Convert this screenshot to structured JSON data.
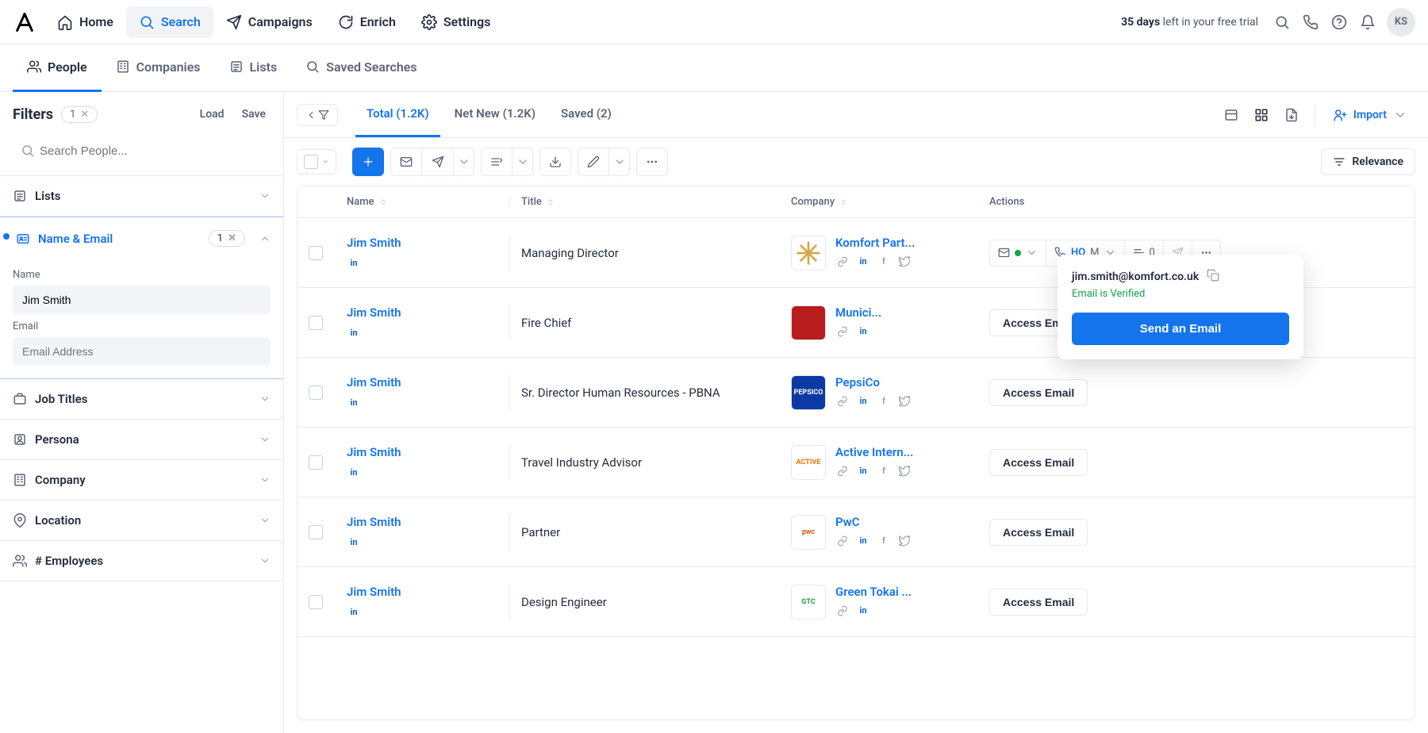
{
  "topnav": {
    "items": [
      {
        "id": "home",
        "label": "Home"
      },
      {
        "id": "search",
        "label": "Search"
      },
      {
        "id": "campaigns",
        "label": "Campaigns"
      },
      {
        "id": "enrich",
        "label": "Enrich"
      },
      {
        "id": "settings",
        "label": "Settings"
      }
    ],
    "trial_bold": "35 days",
    "trial_rest": " left in your free trial",
    "avatar_initials": "KS"
  },
  "subnav": {
    "items": [
      {
        "id": "people",
        "label": "People"
      },
      {
        "id": "companies",
        "label": "Companies"
      },
      {
        "id": "lists",
        "label": "Lists"
      },
      {
        "id": "saved",
        "label": "Saved Searches"
      }
    ]
  },
  "filters": {
    "title": "Filters",
    "count": "1",
    "load": "Load",
    "save": "Save",
    "search_placeholder": "Search People...",
    "name_email": {
      "title": "Name & Email",
      "count": "1",
      "name_label": "Name",
      "name_value": "Jim Smith",
      "email_label": "Email",
      "email_placeholder": "Email Address"
    },
    "sections": [
      {
        "id": "lists",
        "label": "Lists"
      },
      {
        "id": "job_titles",
        "label": "Job Titles"
      },
      {
        "id": "persona",
        "label": "Persona"
      },
      {
        "id": "company",
        "label": "Company"
      },
      {
        "id": "location",
        "label": "Location"
      },
      {
        "id": "employees",
        "label": "# Employees"
      }
    ]
  },
  "tabs": {
    "total": "Total (1.2K)",
    "netnew": "Net New (1.2K)",
    "saved": "Saved (2)",
    "import": "Import"
  },
  "sort": {
    "label": "Relevance"
  },
  "table": {
    "headers": {
      "name": "Name",
      "title": "Title",
      "company": "Company",
      "actions": "Actions"
    },
    "rows": [
      {
        "name": "Jim Smith",
        "title": "Managing Director",
        "company": "Komfort Part...",
        "logo_bg": "#fff",
        "logo_text": "",
        "hq": "HQ",
        "m": "M",
        "zero": "0"
      },
      {
        "name": "Jim Smith",
        "title": "Fire Chief",
        "company": "Munici...",
        "logo_bg": "#b91c1c",
        "logo_text": "",
        "action": "Access Email"
      },
      {
        "name": "Jim Smith",
        "title": "Sr. Director Human Resources - PBNA",
        "company": "PepsiCo",
        "logo_bg": "#0b3aa5",
        "logo_text": "PEPSICO",
        "logo_color": "#fff",
        "action": "Access Email"
      },
      {
        "name": "Jim Smith",
        "title": "Travel Industry Advisor",
        "company": "Active Intern...",
        "logo_bg": "#fff",
        "logo_text": "ACTIVE",
        "logo_color": "#f2720c",
        "action": "Access Email"
      },
      {
        "name": "Jim Smith",
        "title": "Partner",
        "company": "PwC",
        "logo_bg": "#fff",
        "logo_text": "pwc",
        "logo_color": "#d45617",
        "action": "Access Email"
      },
      {
        "name": "Jim Smith",
        "title": "Design Engineer",
        "company": "Green Tokai ...",
        "logo_bg": "#fff",
        "logo_text": "GTC",
        "logo_color": "#16a34a",
        "action": "Access Email"
      }
    ]
  },
  "popover": {
    "email": "jim.smith@komfort.co.uk",
    "verified": "Email is Verified",
    "button": "Send an Email"
  }
}
